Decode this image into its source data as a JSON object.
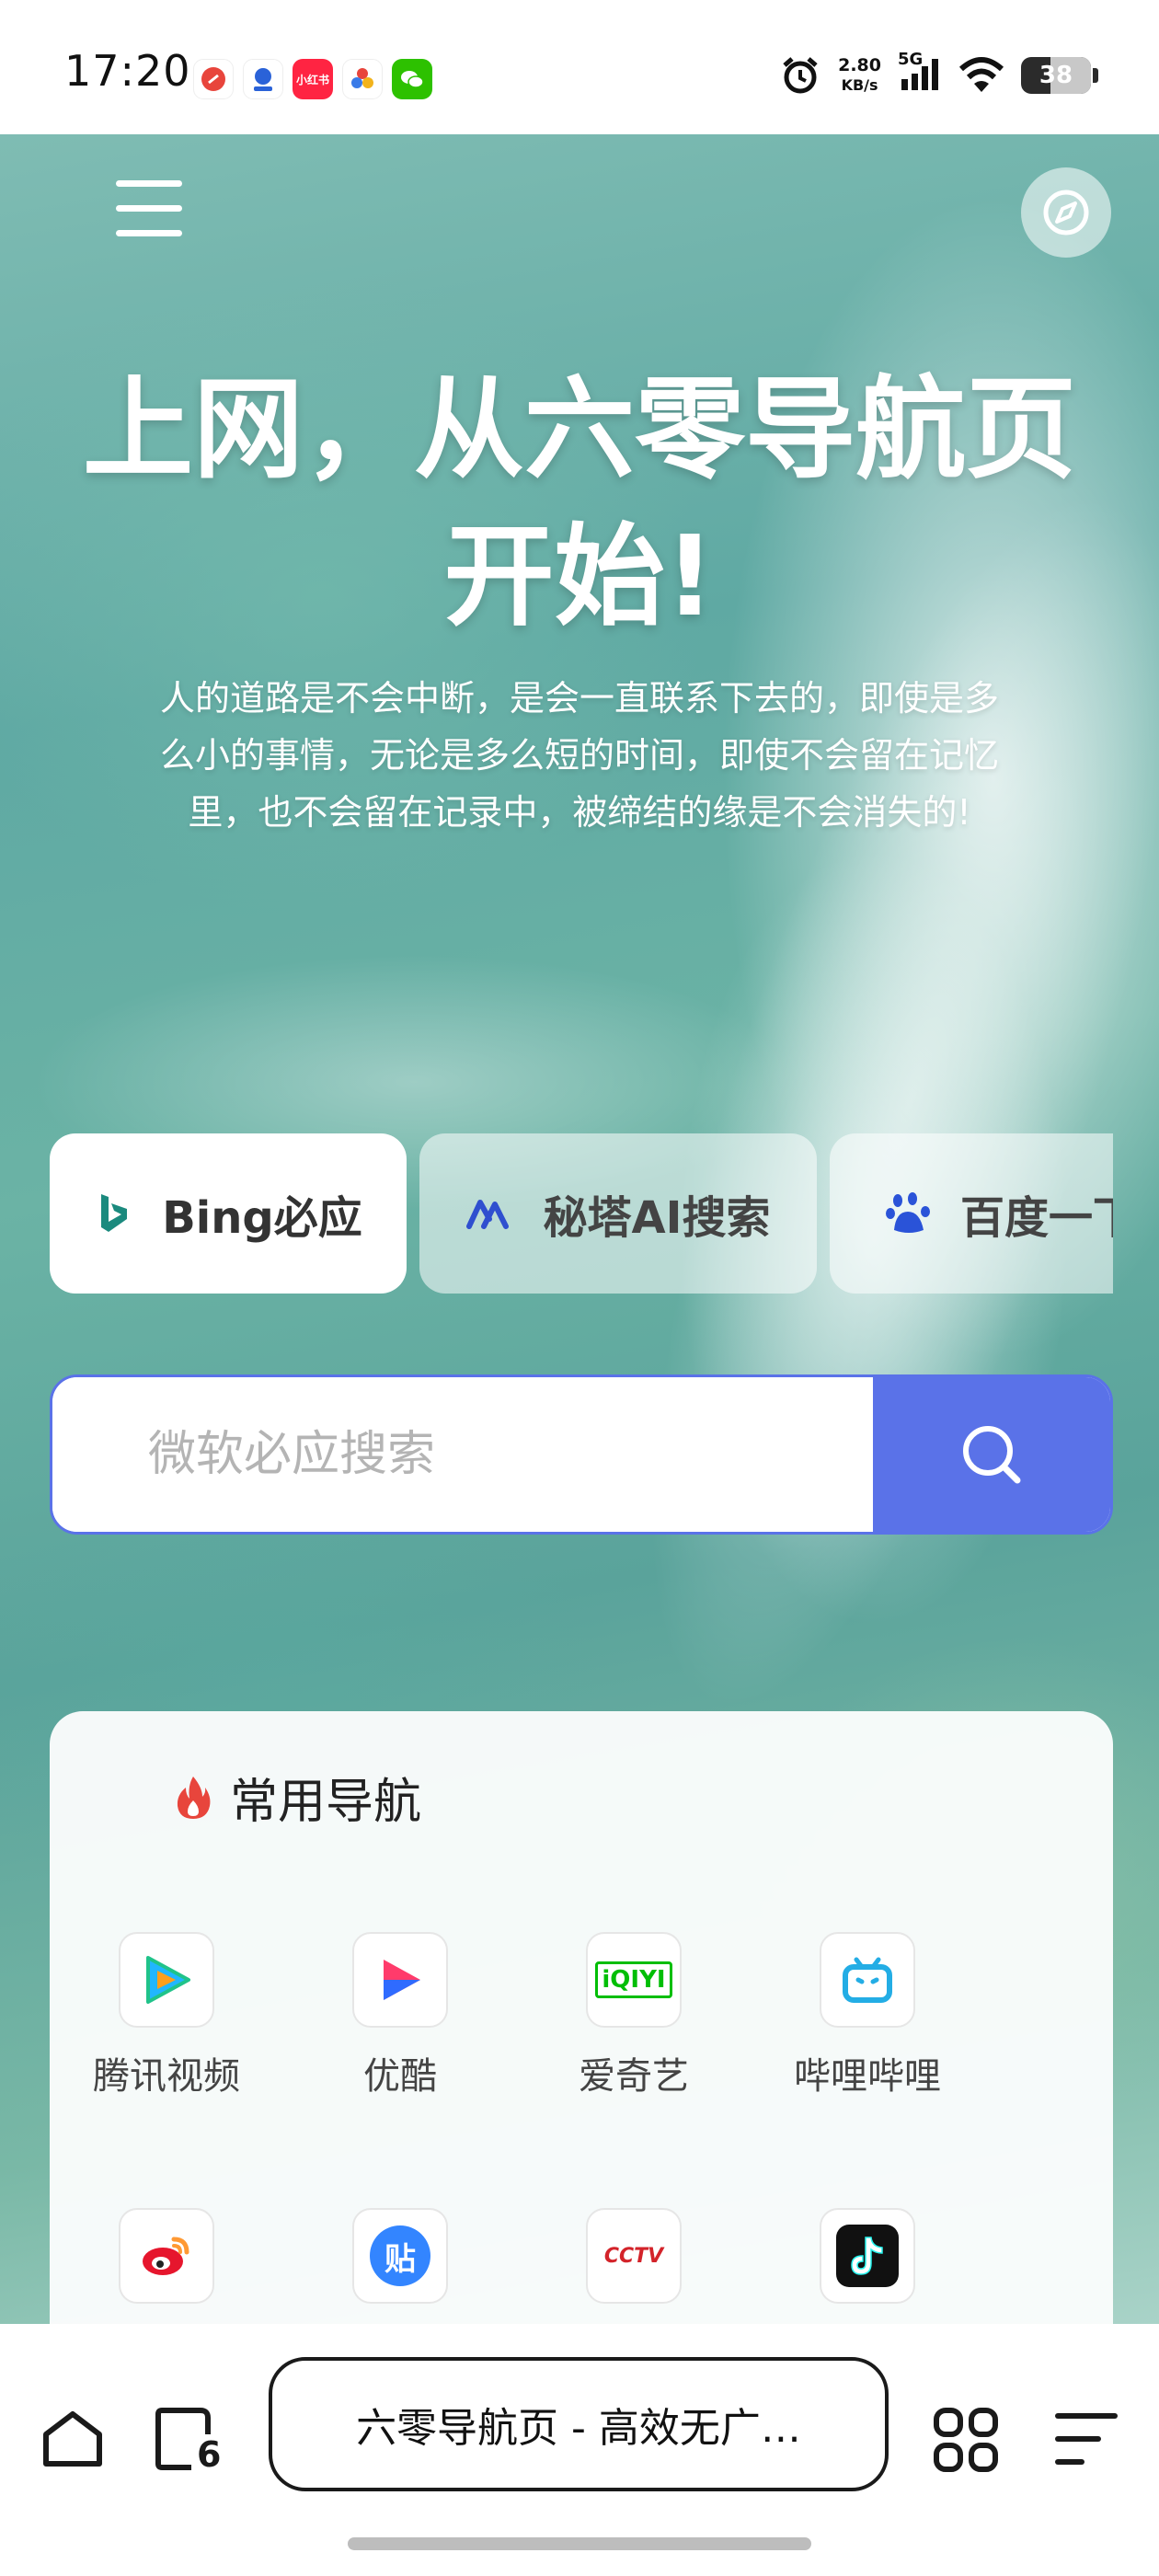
{
  "status_bar": {
    "time": "17:20",
    "net_speed_value": "2.80",
    "net_speed_unit": "KB/s",
    "signal_label": "5G",
    "battery": "38",
    "app_icons": [
      "news-app-icon",
      "map-app-icon",
      "xiaohongshu-icon",
      "cluster-app-icon",
      "wechat-icon"
    ],
    "xiaohongshu_label": "小红书"
  },
  "hero": {
    "title_line1": "上网，从六零导航页",
    "title_line2": "开始!",
    "subtitle": "人的道路是不会中断，是会一直联系下去的，即使是多么小的事情，无论是多么短的时间，即使不会留在记忆里，也不会留在记录中，被缔结的缘是不会消失的!"
  },
  "engines": [
    {
      "label": "Bing必应",
      "icon": "bing-icon",
      "active": true
    },
    {
      "label": "秘塔AI搜索",
      "icon": "metaso-icon",
      "active": false
    },
    {
      "label": "百度一下",
      "icon": "baidu-paw-icon",
      "active": false
    }
  ],
  "search": {
    "placeholder": "微软必应搜索",
    "button_icon": "search-icon"
  },
  "nav": {
    "heading": "常用导航",
    "heading_icon": "flame-icon",
    "items": [
      {
        "label": "腾讯视频",
        "icon": "tencent-video-icon"
      },
      {
        "label": "优酷",
        "icon": "youku-icon"
      },
      {
        "label": "爱奇艺",
        "icon": "iqiyi-icon",
        "icon_text": "iQIYI"
      },
      {
        "label": "哔哩哔哩",
        "icon": "bilibili-icon"
      },
      {
        "label": "",
        "icon": "weibo-icon"
      },
      {
        "label": "",
        "icon": "tieba-icon",
        "icon_text": "贴"
      },
      {
        "label": "",
        "icon": "cctv-icon",
        "icon_text": "CCTV"
      },
      {
        "label": "",
        "icon": "douyin-icon"
      }
    ]
  },
  "bottom_bar": {
    "url_title": "六零导航页 - 高效无广…",
    "tab_count": "6"
  },
  "colors": {
    "accent": "#5a72e8",
    "flame": "#e8453c"
  }
}
